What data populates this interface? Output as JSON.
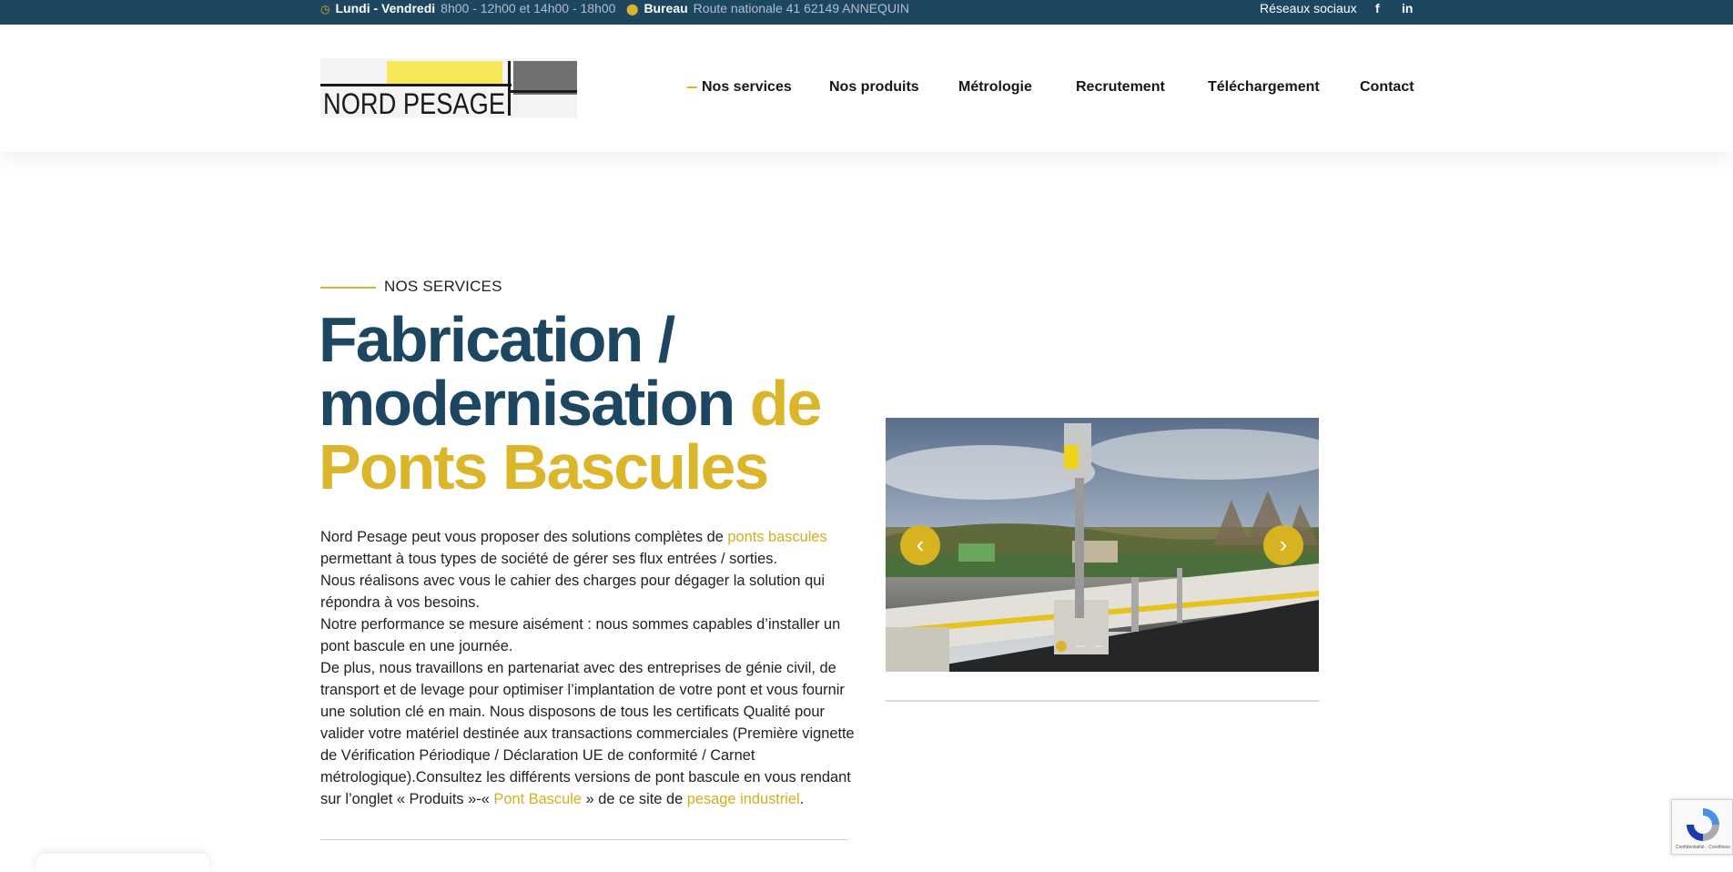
{
  "topbar": {
    "hours_label": "Lundi - Vendredi",
    "hours_value": "8h00 - 12h00 et 14h00 - 18h00",
    "office_label": "Bureau",
    "office_value": "Route nationale 41 62149 ANNEQUIN",
    "social_label": "Réseaux sociaux",
    "facebook": "f",
    "linkedin": "in"
  },
  "header": {
    "logo_text": "NORD PESAGE",
    "nav": [
      "Nos services",
      "Nos produits",
      "Métrologie",
      "Recrutement",
      "Téléchargement",
      "Contact"
    ]
  },
  "main": {
    "eyebrow": "NOS SERVICES",
    "title_part1": "Fabrication / modernisation",
    "title_part2": "de Ponts Bascules",
    "paragraph": {
      "p1_a": "Nord Pesage peut vous proposer des solutions complètes de ",
      "p1_link": "ponts bascules",
      "p1_b": " permettant à tous types de société de gérer ses flux entrées / sorties.",
      "p2": "Nous réalisons avec vous le cahier des charges pour dégager la solution qui répondra à vos besoins.",
      "p3": "Notre performance se mesure aisément : nous sommes capables d’installer un pont bascule en une journée.",
      "p4_a": "De plus, nous travaillons en partenariat avec des entreprises de génie civil, de transport et de levage pour optimiser l’implantation de votre pont et vous fournir une solution clé en main. Nous disposons de tous les certificats Qualité pour valider votre matériel destinée aux transactions commerciales (Première vignette de Vérification Périodique / Déclaration UE de conformité / Carnet métrologique).Consultez les différents versions de pont bascule en vous rendant sur l’onglet « Produits »-« ",
      "p4_link1": "Pont Bascule",
      "p4_b": " » de ce site de ",
      "p4_link2": "pesage industriel",
      "p4_c": "."
    }
  },
  "slider": {
    "prev_icon": "chevron-left-icon",
    "next_icon": "chevron-right-icon",
    "active_index": 0,
    "dots": 3
  },
  "recaptcha": {
    "text": "Confidentialité - Conditions"
  },
  "colors": {
    "navy": "#1d4660",
    "gold": "#dbb62b"
  }
}
